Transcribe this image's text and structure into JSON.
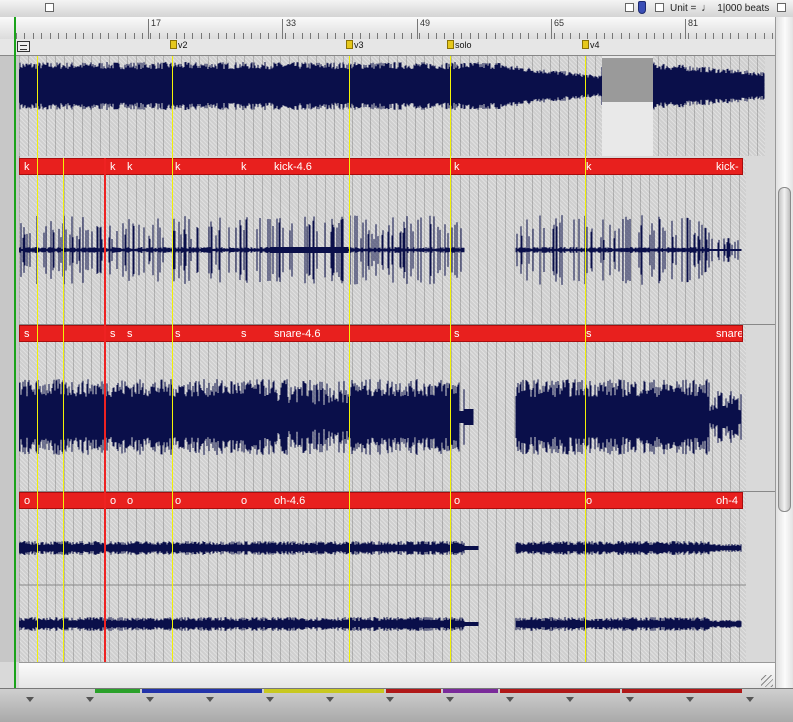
{
  "toolbar": {
    "unit_label": "Unit =",
    "unit_value": "1|000 beats"
  },
  "ruler": {
    "bars": [
      "17",
      "33",
      "49",
      "65",
      "81"
    ]
  },
  "markers": [
    "v2",
    "v3",
    "solo",
    "v4"
  ],
  "tracks": [
    {
      "name": "kick",
      "region_label": "kick-4.6",
      "short_label": "k",
      "end_label": "kick-",
      "style": "spiky"
    },
    {
      "name": "snare",
      "region_label": "snare-4.6",
      "short_label": "s",
      "end_label": "snare",
      "style": "dense"
    },
    {
      "name": "oh",
      "region_label": "oh-4.6",
      "short_label": "o",
      "end_label": "oh-4",
      "style": "stereo"
    }
  ],
  "colors": {
    "waveform": "#0a0f4a",
    "region": "#e8201e",
    "marker": "#e6c81c",
    "playhead": "#e22222",
    "position_line": "#1aa31a"
  },
  "icons": [
    "checkbox-icon",
    "flag-icon",
    "note-icon",
    "sequencer-icon",
    "marker-pin-icon",
    "resize-grip-icon"
  ]
}
